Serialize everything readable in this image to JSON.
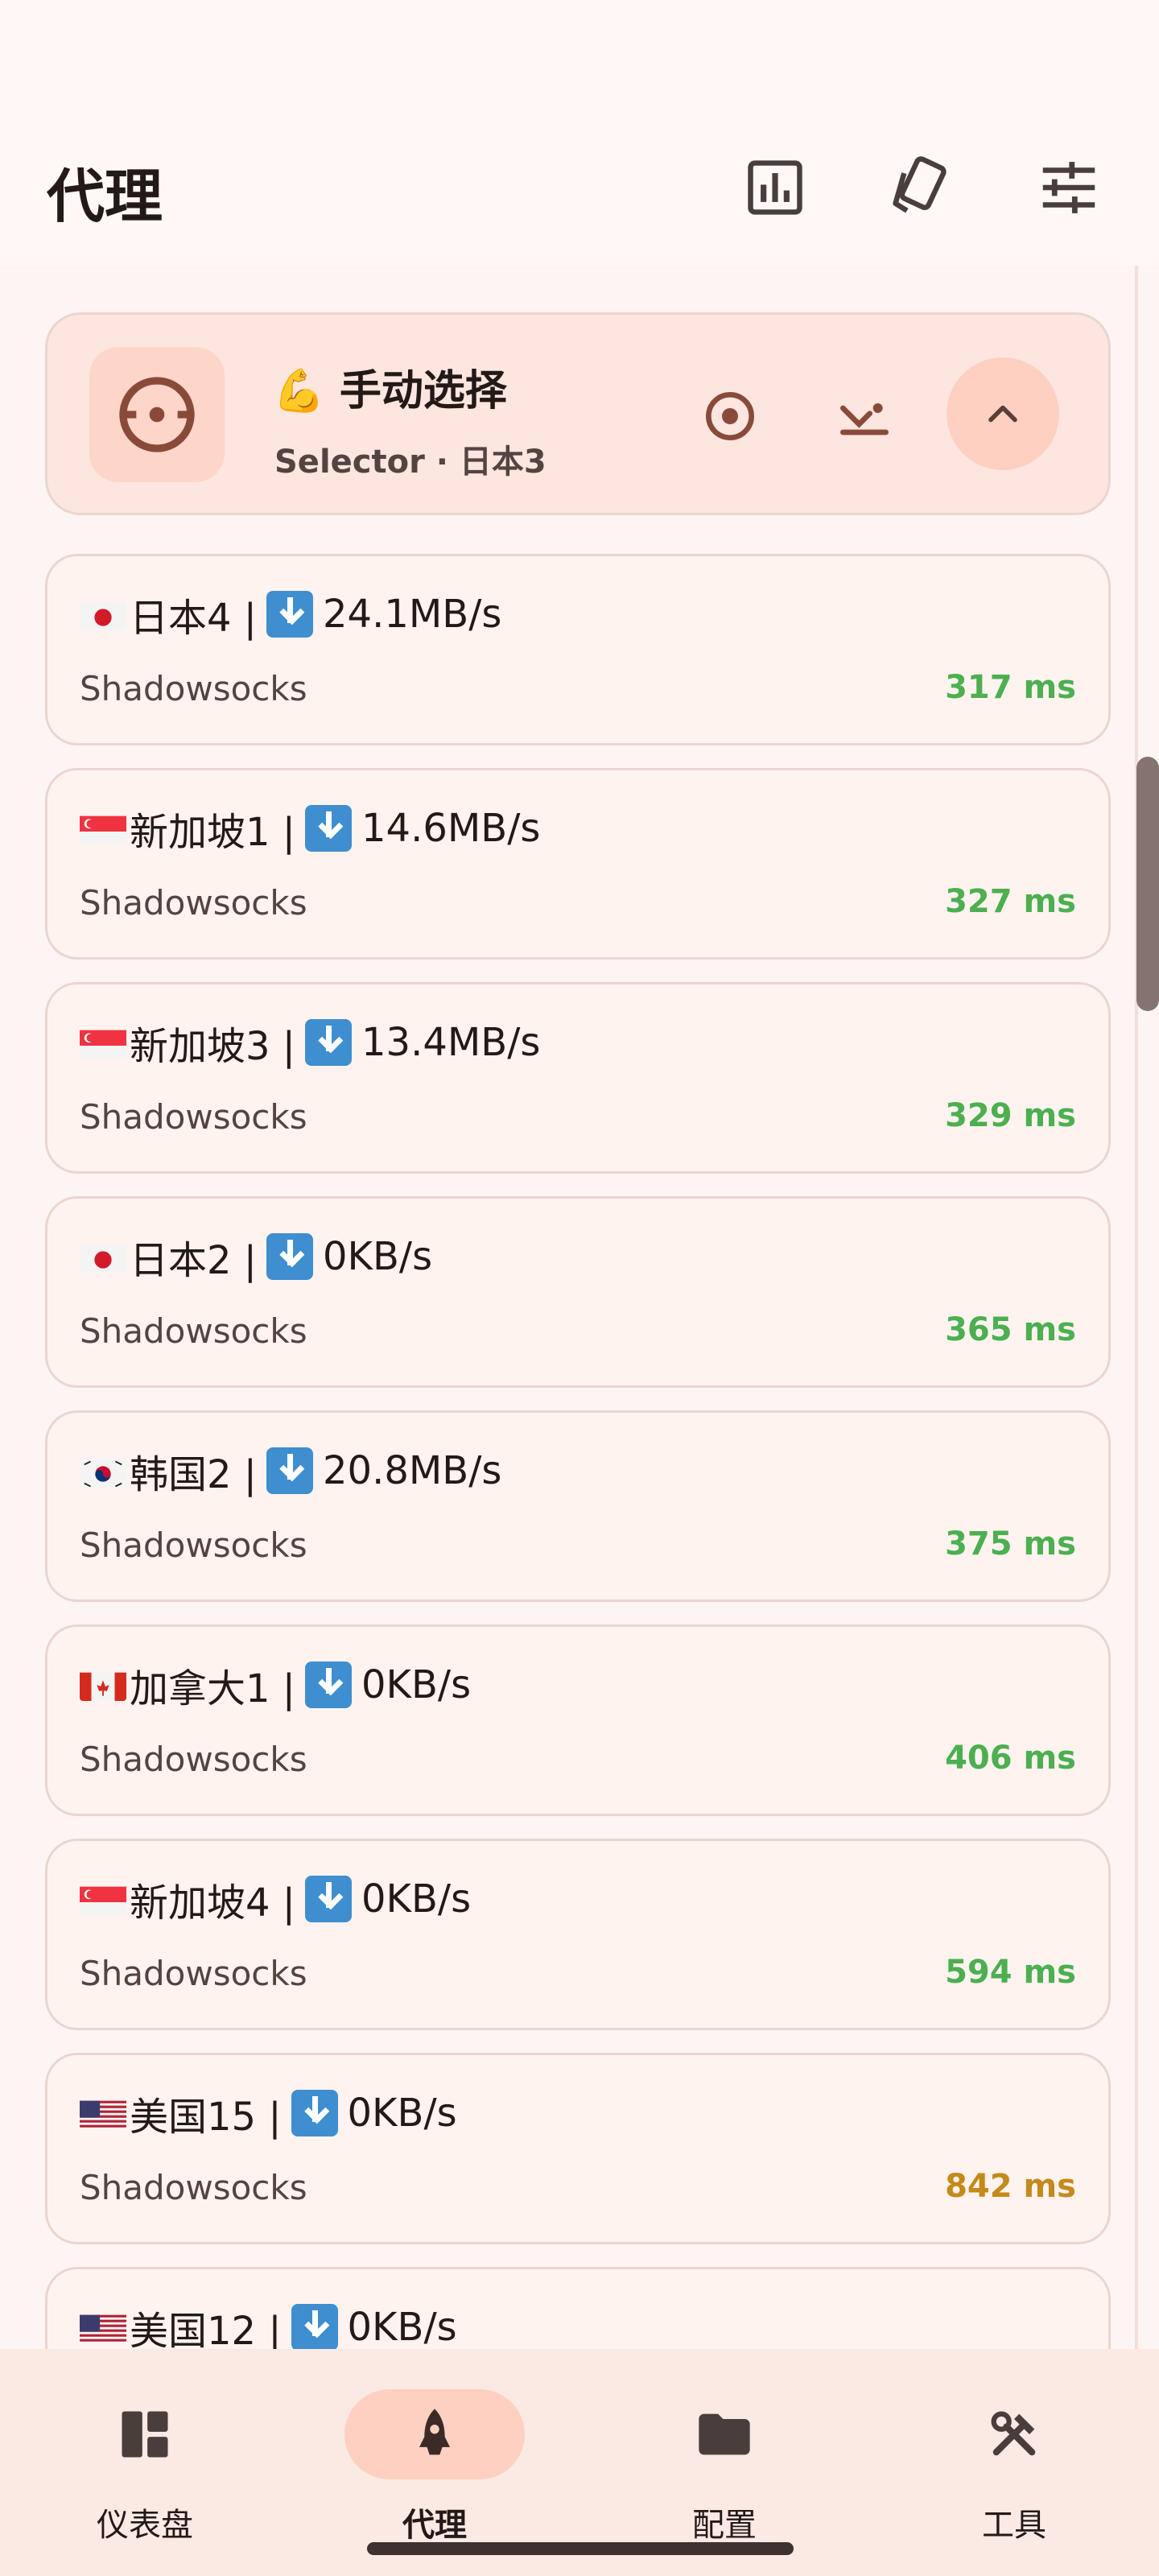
{
  "header": {
    "title": "代理",
    "icons": [
      "chart-icon",
      "cards-icon",
      "tune-icon"
    ]
  },
  "group": {
    "emoji": "💪",
    "title": "手动选择",
    "subtitle": "Selector · 日本3",
    "icons": [
      "radio-target-icon",
      "locate-icon",
      "chevron-up-icon"
    ]
  },
  "proxies": [
    {
      "flag": "jp",
      "name": "日本4 |",
      "speed": "24.1MB/s",
      "type": "Shadowsocks",
      "delay": "317 ms"
    },
    {
      "flag": "sg",
      "name": "新加坡1 |",
      "speed": "14.6MB/s",
      "type": "Shadowsocks",
      "delay": "327 ms"
    },
    {
      "flag": "sg",
      "name": "新加坡3 |",
      "speed": "13.4MB/s",
      "type": "Shadowsocks",
      "delay": "329 ms"
    },
    {
      "flag": "jp",
      "name": "日本2 |",
      "speed": "0KB/s",
      "type": "Shadowsocks",
      "delay": "365 ms"
    },
    {
      "flag": "kr",
      "name": "韩国2 |",
      "speed": "20.8MB/s",
      "type": "Shadowsocks",
      "delay": "375 ms"
    },
    {
      "flag": "ca",
      "name": "加拿大1 |",
      "speed": "0KB/s",
      "type": "Shadowsocks",
      "delay": "406 ms"
    },
    {
      "flag": "sg",
      "name": "新加坡4 |",
      "speed": "0KB/s",
      "type": "Shadowsocks",
      "delay": "594 ms"
    },
    {
      "flag": "us",
      "name": "美国15 |",
      "speed": "0KB/s",
      "type": "Shadowsocks",
      "delay": "842 ms"
    },
    {
      "flag": "us",
      "name": "美国12 |",
      "speed": "0KB/s",
      "type": "",
      "delay": ""
    }
  ],
  "nav": [
    {
      "label": "仪表盘",
      "icon": "dashboard-icon",
      "active": false
    },
    {
      "label": "代理",
      "icon": "rocket-icon",
      "active": true
    },
    {
      "label": "配置",
      "icon": "folder-icon",
      "active": false
    },
    {
      "label": "工具",
      "icon": "tools-icon",
      "active": false
    }
  ],
  "colors": {
    "accent": "#8a4a3a",
    "delay_good": "#4caf50",
    "delay_mid": "#c48a1a",
    "download_badge": "#3e8ed0"
  }
}
